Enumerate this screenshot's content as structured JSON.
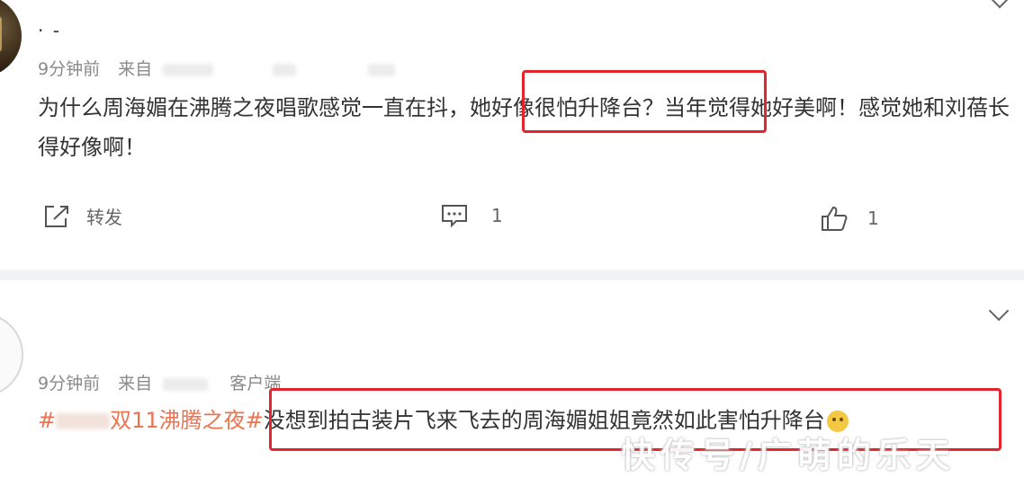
{
  "post1": {
    "username": "· -",
    "time": "9分钟前",
    "source_prefix": "来自",
    "text": "为什么周海媚在沸腾之夜唱歌感觉一直在抖，她好像很怕升降台？当年觉得她好美啊！感觉她和刘蓓长得好像啊！",
    "actions": {
      "share_label": "转发",
      "comment_count": "1",
      "like_count": "1"
    }
  },
  "post2": {
    "time": "9分钟前",
    "source_prefix": "来自",
    "source_suffix": "客户端",
    "topic_prefix": "#",
    "topic_visible": "双11沸腾之夜#",
    "text": "没想到拍古装片飞来飞去的周海媚姐姐竟然如此害怕升降台"
  },
  "watermark": "快传号/广萌的乐天",
  "icons": {
    "share": "share-icon",
    "comment": "comment-icon",
    "like": "thumbs-up-icon",
    "expand": "chevron-down-icon"
  },
  "colors": {
    "highlight": "#e3262d",
    "topic": "#eb7350",
    "meta": "#8a8a8a",
    "divider": "#f2f3f5"
  }
}
